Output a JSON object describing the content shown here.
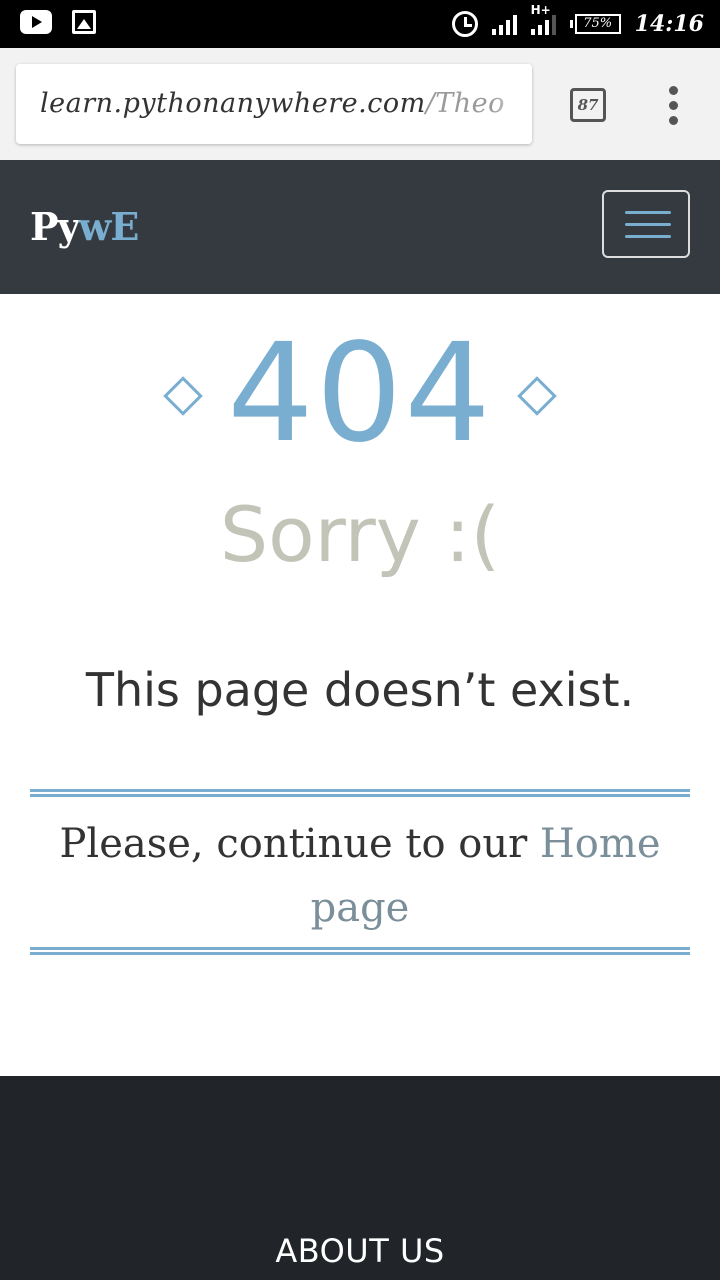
{
  "status_bar": {
    "left_icons": [
      "youtube-icon",
      "image-icon"
    ],
    "network": "H+",
    "battery": "75%",
    "time": "14:16"
  },
  "browser": {
    "url_host": "learn.pythonanywhere.com",
    "url_path": "/Theo",
    "tab_count": "87"
  },
  "site": {
    "brand_part1": "Py",
    "brand_part2": "wE",
    "accent_color": "#79aed0",
    "nav_bg": "#343a40"
  },
  "error": {
    "code": "404",
    "title": "Sorry :(",
    "message": "This page doesn’t exist.",
    "continue_prefix": "Please, continue to our ",
    "home_link": "Home page"
  },
  "footer": {
    "heading": "ABOUT US"
  }
}
